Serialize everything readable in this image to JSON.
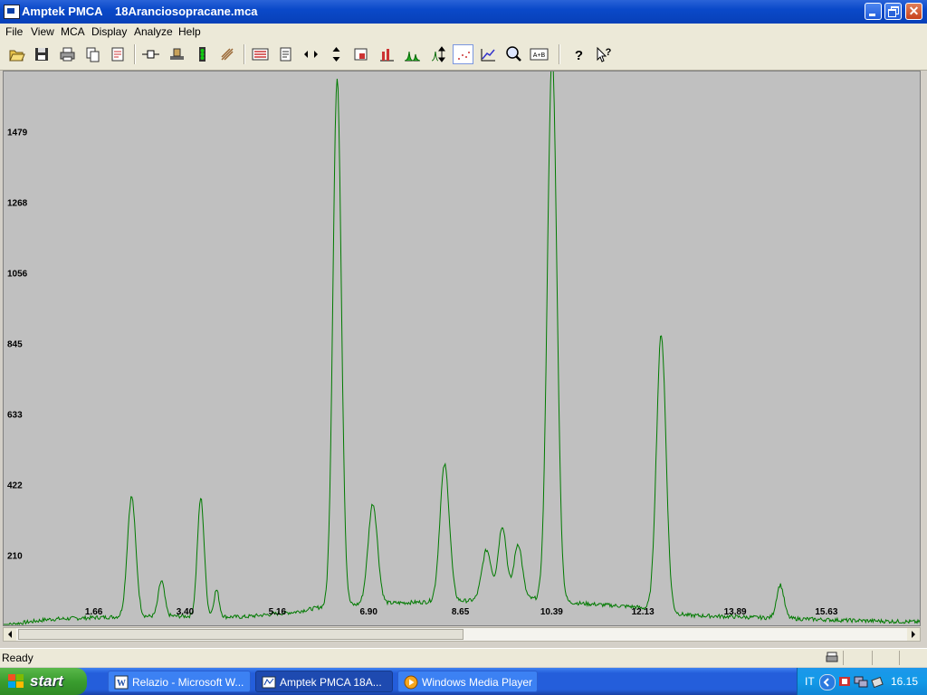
{
  "window": {
    "app_name": "Amptek PMCA",
    "file_name": "18Aranciosopracane.mca"
  },
  "menu": [
    "File",
    "View",
    "MCA",
    "Display",
    "Analyze",
    "Help"
  ],
  "toolbar": {
    "buttons": [
      "open-icon",
      "save-icon",
      "print-icon",
      "copy-icon",
      "print-preview-icon",
      "connect-icon",
      "acquisition-setup-icon",
      "traffic-light-icon",
      "calibrate-icon",
      "roi-icon",
      "report-icon",
      "horizontal-expand-icon",
      "vertical-expand-icon",
      "roi-zoom-icon",
      "bar-display-icon",
      "peak-display-icon",
      "auto-scale-icon",
      "point-display-icon",
      "line-display-icon",
      "zoom-icon",
      "a-plus-b-icon",
      "help-icon",
      "context-help-icon"
    ],
    "a_plus_b_label": "A+B",
    "active": "point-display-icon"
  },
  "chart_data": {
    "type": "line",
    "series_color": "#007a00",
    "background": "#c0c0c0",
    "y_tick_labels": [
      "1479",
      "1268",
      "1056",
      "845",
      "633",
      "422",
      "210"
    ],
    "y_ticks": [
      1479,
      1268,
      1056,
      845,
      633,
      422,
      210
    ],
    "x_tick_labels": [
      "1.66",
      "3.40",
      "5.16",
      "6.90",
      "8.65",
      "10.39",
      "12.13",
      "13.89",
      "15.63"
    ],
    "x_ticks": [
      1.66,
      3.4,
      5.16,
      6.9,
      8.65,
      10.39,
      12.13,
      13.89,
      15.63
    ],
    "xlim": [
      -0.06,
      17.41
    ],
    "ylim": [
      0,
      1660
    ],
    "baseline": 15,
    "peaks": [
      {
        "x": 2.38,
        "y": 360,
        "width": 0.08
      },
      {
        "x": 2.95,
        "y": 105,
        "width": 0.06
      },
      {
        "x": 3.7,
        "y": 355,
        "width": 0.065
      },
      {
        "x": 4.0,
        "y": 80,
        "width": 0.05
      },
      {
        "x": 6.3,
        "y": 1580,
        "width": 0.08
      },
      {
        "x": 6.98,
        "y": 300,
        "width": 0.09
      },
      {
        "x": 8.35,
        "y": 410,
        "width": 0.09
      },
      {
        "x": 9.15,
        "y": 150,
        "width": 0.09
      },
      {
        "x": 9.45,
        "y": 220,
        "width": 0.08
      },
      {
        "x": 9.75,
        "y": 165,
        "width": 0.08
      },
      {
        "x": 10.4,
        "y": 1640,
        "width": 0.09
      },
      {
        "x": 12.48,
        "y": 830,
        "width": 0.09
      },
      {
        "x": 14.75,
        "y": 100,
        "width": 0.07
      }
    ],
    "background_levels": [
      {
        "x": -0.06,
        "y": 0
      },
      {
        "x": 0.8,
        "y": 18
      },
      {
        "x": 2.0,
        "y": 25
      },
      {
        "x": 3.0,
        "y": 28
      },
      {
        "x": 4.5,
        "y": 25
      },
      {
        "x": 5.5,
        "y": 40
      },
      {
        "x": 6.0,
        "y": 55
      },
      {
        "x": 7.0,
        "y": 65
      },
      {
        "x": 8.0,
        "y": 70
      },
      {
        "x": 9.0,
        "y": 75
      },
      {
        "x": 10.0,
        "y": 80
      },
      {
        "x": 11.0,
        "y": 65
      },
      {
        "x": 12.0,
        "y": 55
      },
      {
        "x": 13.0,
        "y": 30
      },
      {
        "x": 14.0,
        "y": 25
      },
      {
        "x": 15.0,
        "y": 20
      },
      {
        "x": 16.0,
        "y": 15
      },
      {
        "x": 17.41,
        "y": 10
      }
    ]
  },
  "status": {
    "text": "Ready"
  },
  "taskbar": {
    "start_label": "start",
    "tasks": [
      {
        "label": "Relazio - Microsoft W...",
        "icon": "word-icon",
        "active": false
      },
      {
        "label": "Amptek PMCA     18A...",
        "icon": "pmca-icon",
        "active": true
      },
      {
        "label": "Windows Media Player",
        "icon": "media-player-icon",
        "active": false
      }
    ],
    "tray": {
      "language": "IT",
      "clock": "16.15"
    }
  }
}
